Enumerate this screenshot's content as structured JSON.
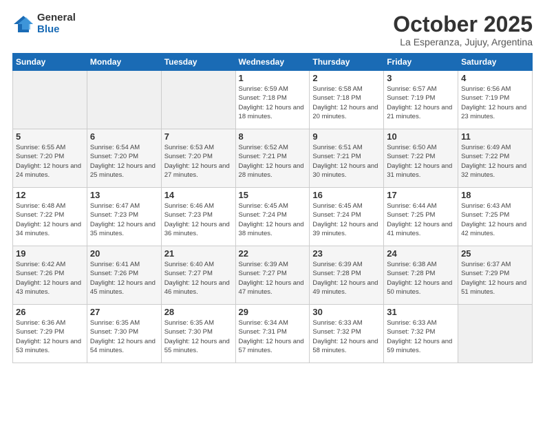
{
  "logo": {
    "general": "General",
    "blue": "Blue"
  },
  "header": {
    "title": "October 2025",
    "subtitle": "La Esperanza, Jujuy, Argentina"
  },
  "days_of_week": [
    "Sunday",
    "Monday",
    "Tuesday",
    "Wednesday",
    "Thursday",
    "Friday",
    "Saturday"
  ],
  "weeks": [
    [
      {
        "day": "",
        "info": ""
      },
      {
        "day": "",
        "info": ""
      },
      {
        "day": "",
        "info": ""
      },
      {
        "day": "1",
        "info": "Sunrise: 6:59 AM\nSunset: 7:18 PM\nDaylight: 12 hours and 18 minutes."
      },
      {
        "day": "2",
        "info": "Sunrise: 6:58 AM\nSunset: 7:18 PM\nDaylight: 12 hours and 20 minutes."
      },
      {
        "day": "3",
        "info": "Sunrise: 6:57 AM\nSunset: 7:19 PM\nDaylight: 12 hours and 21 minutes."
      },
      {
        "day": "4",
        "info": "Sunrise: 6:56 AM\nSunset: 7:19 PM\nDaylight: 12 hours and 23 minutes."
      }
    ],
    [
      {
        "day": "5",
        "info": "Sunrise: 6:55 AM\nSunset: 7:20 PM\nDaylight: 12 hours and 24 minutes."
      },
      {
        "day": "6",
        "info": "Sunrise: 6:54 AM\nSunset: 7:20 PM\nDaylight: 12 hours and 25 minutes."
      },
      {
        "day": "7",
        "info": "Sunrise: 6:53 AM\nSunset: 7:20 PM\nDaylight: 12 hours and 27 minutes."
      },
      {
        "day": "8",
        "info": "Sunrise: 6:52 AM\nSunset: 7:21 PM\nDaylight: 12 hours and 28 minutes."
      },
      {
        "day": "9",
        "info": "Sunrise: 6:51 AM\nSunset: 7:21 PM\nDaylight: 12 hours and 30 minutes."
      },
      {
        "day": "10",
        "info": "Sunrise: 6:50 AM\nSunset: 7:22 PM\nDaylight: 12 hours and 31 minutes."
      },
      {
        "day": "11",
        "info": "Sunrise: 6:49 AM\nSunset: 7:22 PM\nDaylight: 12 hours and 32 minutes."
      }
    ],
    [
      {
        "day": "12",
        "info": "Sunrise: 6:48 AM\nSunset: 7:22 PM\nDaylight: 12 hours and 34 minutes."
      },
      {
        "day": "13",
        "info": "Sunrise: 6:47 AM\nSunset: 7:23 PM\nDaylight: 12 hours and 35 minutes."
      },
      {
        "day": "14",
        "info": "Sunrise: 6:46 AM\nSunset: 7:23 PM\nDaylight: 12 hours and 36 minutes."
      },
      {
        "day": "15",
        "info": "Sunrise: 6:45 AM\nSunset: 7:24 PM\nDaylight: 12 hours and 38 minutes."
      },
      {
        "day": "16",
        "info": "Sunrise: 6:45 AM\nSunset: 7:24 PM\nDaylight: 12 hours and 39 minutes."
      },
      {
        "day": "17",
        "info": "Sunrise: 6:44 AM\nSunset: 7:25 PM\nDaylight: 12 hours and 41 minutes."
      },
      {
        "day": "18",
        "info": "Sunrise: 6:43 AM\nSunset: 7:25 PM\nDaylight: 12 hours and 42 minutes."
      }
    ],
    [
      {
        "day": "19",
        "info": "Sunrise: 6:42 AM\nSunset: 7:26 PM\nDaylight: 12 hours and 43 minutes."
      },
      {
        "day": "20",
        "info": "Sunrise: 6:41 AM\nSunset: 7:26 PM\nDaylight: 12 hours and 45 minutes."
      },
      {
        "day": "21",
        "info": "Sunrise: 6:40 AM\nSunset: 7:27 PM\nDaylight: 12 hours and 46 minutes."
      },
      {
        "day": "22",
        "info": "Sunrise: 6:39 AM\nSunset: 7:27 PM\nDaylight: 12 hours and 47 minutes."
      },
      {
        "day": "23",
        "info": "Sunrise: 6:39 AM\nSunset: 7:28 PM\nDaylight: 12 hours and 49 minutes."
      },
      {
        "day": "24",
        "info": "Sunrise: 6:38 AM\nSunset: 7:28 PM\nDaylight: 12 hours and 50 minutes."
      },
      {
        "day": "25",
        "info": "Sunrise: 6:37 AM\nSunset: 7:29 PM\nDaylight: 12 hours and 51 minutes."
      }
    ],
    [
      {
        "day": "26",
        "info": "Sunrise: 6:36 AM\nSunset: 7:29 PM\nDaylight: 12 hours and 53 minutes."
      },
      {
        "day": "27",
        "info": "Sunrise: 6:35 AM\nSunset: 7:30 PM\nDaylight: 12 hours and 54 minutes."
      },
      {
        "day": "28",
        "info": "Sunrise: 6:35 AM\nSunset: 7:30 PM\nDaylight: 12 hours and 55 minutes."
      },
      {
        "day": "29",
        "info": "Sunrise: 6:34 AM\nSunset: 7:31 PM\nDaylight: 12 hours and 57 minutes."
      },
      {
        "day": "30",
        "info": "Sunrise: 6:33 AM\nSunset: 7:32 PM\nDaylight: 12 hours and 58 minutes."
      },
      {
        "day": "31",
        "info": "Sunrise: 6:33 AM\nSunset: 7:32 PM\nDaylight: 12 hours and 59 minutes."
      },
      {
        "day": "",
        "info": ""
      }
    ]
  ]
}
